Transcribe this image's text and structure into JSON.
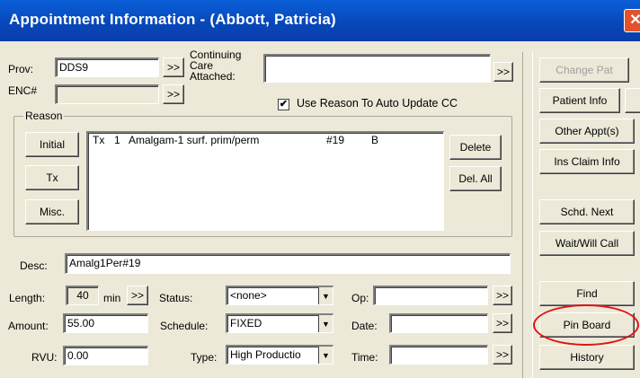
{
  "window": {
    "title": "Appointment Information - (Abbott, Patricia)",
    "close_glyph": "✕"
  },
  "prov": {
    "label": "Prov:",
    "value": "DDS9",
    "more": ">>"
  },
  "enc": {
    "label": "ENC#",
    "value": "",
    "more": ">>"
  },
  "continuing_care": {
    "label": "Continuing\nCare\nAttached:",
    "value": "",
    "more": ">>"
  },
  "use_reason": {
    "label": "Use Reason To Auto Update CC",
    "checked": "✔"
  },
  "reason": {
    "title": "Reason",
    "buttons": {
      "initial": "Initial",
      "tx": "Tx",
      "misc": "Misc."
    },
    "items": [
      {
        "code": "Tx",
        "num": "1",
        "desc": "Amalgam-1 surf. prim/perm",
        "tooth": "#19",
        "surface": "B"
      }
    ],
    "delete": "Delete",
    "delete_all": "Del. All"
  },
  "desc": {
    "label": "Desc:",
    "value": "Amalg1Per#19"
  },
  "length": {
    "label": "Length:",
    "value": "40",
    "unit": "min",
    "more": ">>"
  },
  "amount": {
    "label": "Amount:",
    "value": "55.00"
  },
  "rvu": {
    "label": "RVU:",
    "value": "0.00"
  },
  "status": {
    "label": "Status:",
    "value": "<none>"
  },
  "schedule": {
    "label": "Schedule:",
    "value": "FIXED"
  },
  "type": {
    "label": "Type:",
    "value": "High Productio"
  },
  "op": {
    "label": "Op:",
    "value": "",
    "more": ">>"
  },
  "date": {
    "label": "Date:",
    "value": "",
    "more": ">>"
  },
  "time": {
    "label": "Time:",
    "value": "",
    "more": ">>"
  },
  "side": {
    "change_pat": "Change Pat",
    "patient_info": "Patient Info",
    "other_appts": "Other Appt(s)",
    "ins_claim": "Ins Claim Info",
    "schd_next": "Schd. Next",
    "wait_will_call": "Wait/Will Call",
    "find": "Find",
    "pin_board": "Pin Board",
    "history": "History"
  }
}
